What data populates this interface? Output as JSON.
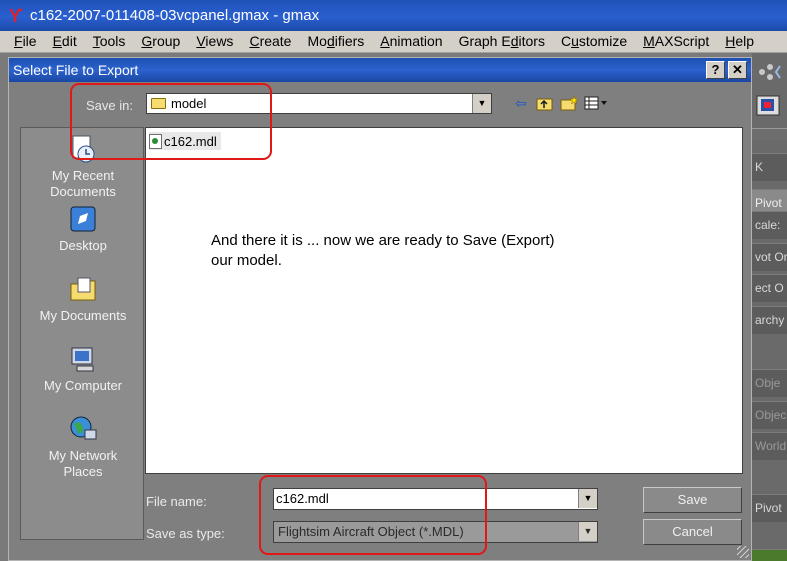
{
  "app": {
    "title": "c162-2007-011408-03vcpanel.gmax - gmax",
    "icon": "gmax-logo-icon"
  },
  "menu": [
    {
      "accel": "F",
      "rest": "ile"
    },
    {
      "accel": "E",
      "rest": "dit"
    },
    {
      "accel": "T",
      "rest": "ools"
    },
    {
      "accel": "G",
      "rest": "roup"
    },
    {
      "accel": "V",
      "rest": "iews"
    },
    {
      "accel": "C",
      "rest": "reate"
    },
    {
      "pre": "Mo",
      "accel": "d",
      "rest": "ifiers"
    },
    {
      "accel": "A",
      "rest": "nimation"
    },
    {
      "pre": "Graph E",
      "accel": "d",
      "rest": "itors"
    },
    {
      "pre": "C",
      "accel": "u",
      "rest": "stomize"
    },
    {
      "accel": "M",
      "rest": "AXScript"
    },
    {
      "accel": "H",
      "rest": "elp"
    }
  ],
  "dialog": {
    "title": "Select File to Export",
    "help_button": "?",
    "close_button": "✕",
    "save_in_label": "Save in:",
    "save_in_value": "model",
    "files": [
      {
        "name": "c162.mdl"
      }
    ],
    "annotation_line1": "And there it is ... now we are ready to Save (Export)",
    "annotation_line2": "our model.",
    "places": [
      {
        "label1": "My Recent",
        "label2": "Documents",
        "icon": "recent-documents-icon"
      },
      {
        "label1": "Desktop",
        "label2": "",
        "icon": "desktop-icon"
      },
      {
        "label1": "My Documents",
        "label2": "",
        "icon": "my-documents-icon"
      },
      {
        "label1": "My Computer",
        "label2": "",
        "icon": "my-computer-icon"
      },
      {
        "label1": "My Network",
        "label2": "Places",
        "icon": "network-places-icon"
      }
    ],
    "file_name_label": "File name:",
    "file_name_value": "c162.mdl",
    "save_as_type_label": "Save as type:",
    "save_as_type_value": "Flightsim Aircraft Object (*.MDL)",
    "save_button": "Save",
    "cancel_button": "Cancel"
  },
  "side_panel": {
    "rows": [
      "K",
      "Pivot",
      "cale:",
      "vot Or",
      "ect O",
      "archy",
      "Obje",
      "Objec",
      "World",
      "Pivot"
    ]
  },
  "colors": {
    "title_bar": "#2a5fcf",
    "highlight": "#e01818"
  }
}
